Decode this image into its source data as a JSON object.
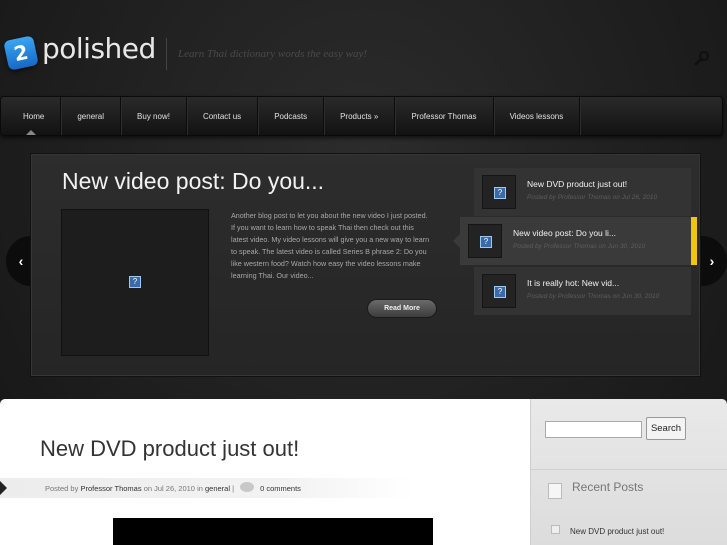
{
  "header": {
    "logo_badge": "2",
    "logo_text": "polished",
    "tagline": "Learn Thai dictionary words the easy way!"
  },
  "nav": {
    "items": [
      {
        "label": "Home"
      },
      {
        "label": "general"
      },
      {
        "label": "Buy now!"
      },
      {
        "label": "Contact us"
      },
      {
        "label": "Podcasts"
      },
      {
        "label": "Products »"
      },
      {
        "label": "Professor Thomas"
      },
      {
        "label": "Videos lessons"
      }
    ]
  },
  "slider": {
    "title": "New video post: Do you...",
    "excerpt": "Another blog post to let you about the new video I just posted. If you want to learn how to speak Thai then check out this latest video. My video lessons will give you a new way to learn to speak. The latest video is called Series B phrase 2: Do you like western food? Watch how easy the video lessons make learning Thai. Our video...",
    "read_more": "Read More",
    "thumbs": [
      {
        "title": "New DVD product just out!",
        "meta": "Posted by Professor Thomas on Jul 26, 2010"
      },
      {
        "title": "New video post: Do you li...",
        "meta": "Posted by Professor Thomas on Jun 30, 2010"
      },
      {
        "title": "It is really hot: New vid...",
        "meta": "Posted by Professor Thomas on Jun 30, 2010"
      }
    ]
  },
  "post": {
    "title": "New DVD product just out!",
    "posted_by": "Posted by",
    "author": "Professor Thomas",
    "on": "on Jul 26, 2010 in",
    "category": "general",
    "sep": "|",
    "comments": "0 comments"
  },
  "sidebar": {
    "search_button": "Search",
    "search_value": "",
    "recent_title": "Recent Posts",
    "recent_posts": [
      "New DVD product just out!"
    ]
  },
  "colors": {
    "accent": "#f1c40f",
    "logo_blue": "#1e88e5",
    "background": "#1e1e1e"
  }
}
